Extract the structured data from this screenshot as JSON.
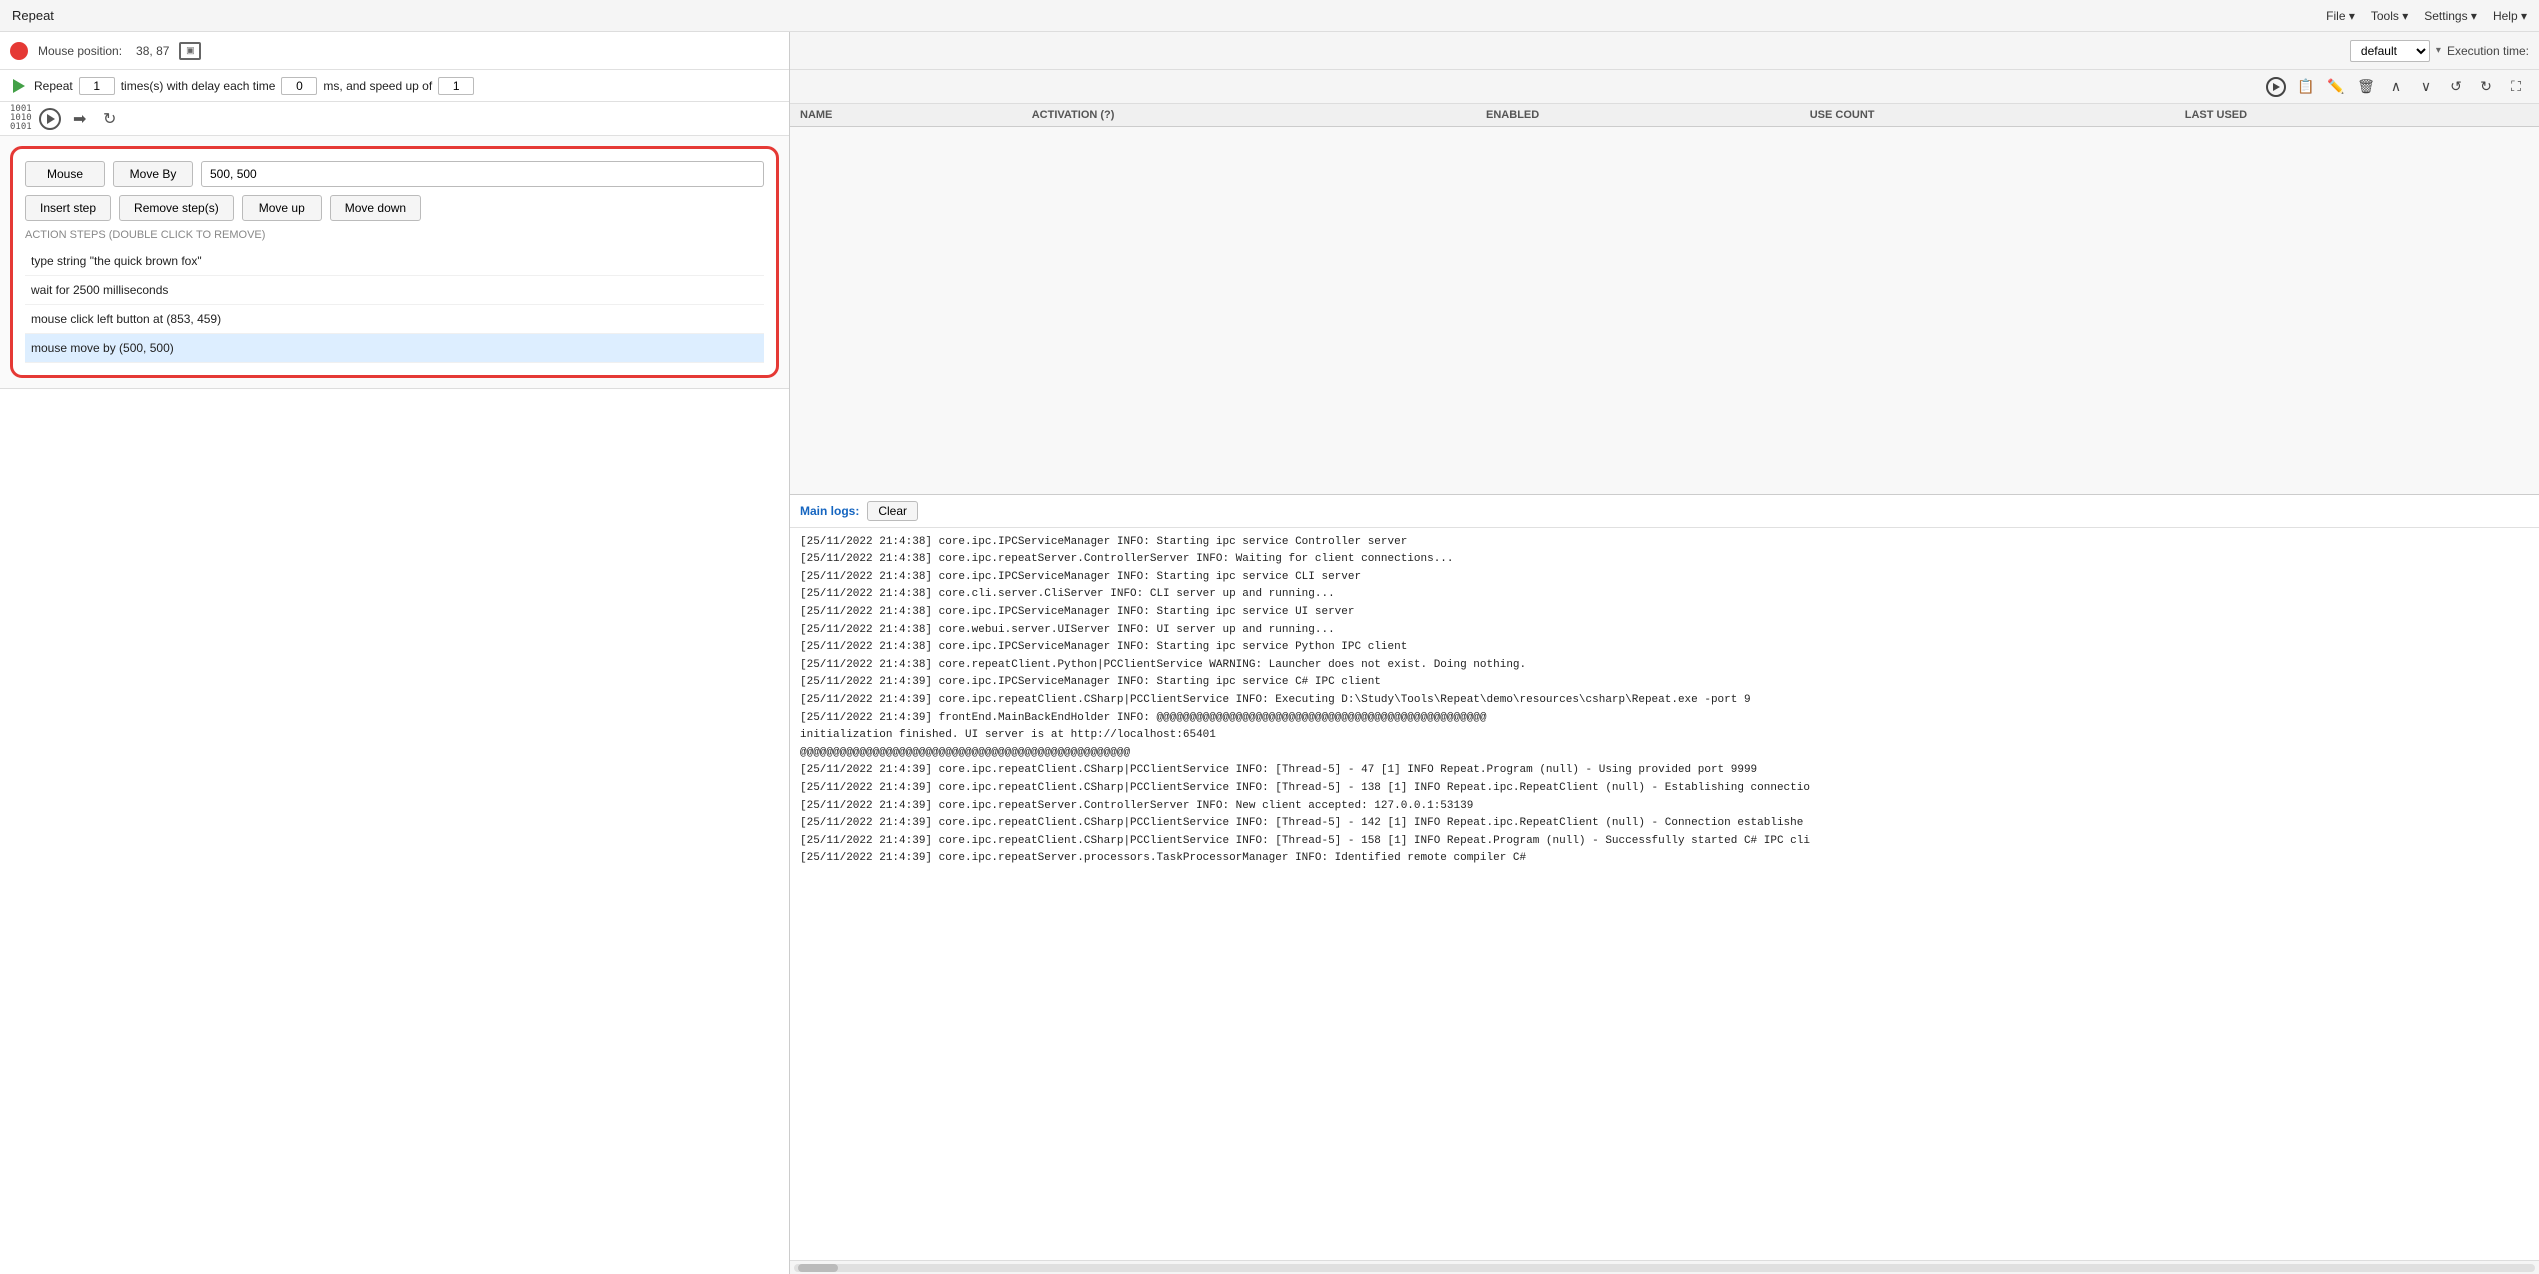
{
  "titlebar": {
    "title": "Repeat",
    "menu": [
      "File ▾",
      "Tools ▾",
      "Settings ▾",
      "Help ▾"
    ]
  },
  "toolbar": {
    "mouse_position_label": "Mouse position:",
    "mouse_position_value": "38, 87",
    "repeat_label": "Repeat",
    "repeat_times": "1",
    "repeat_delay_label": "times(s) with delay each time",
    "repeat_delay_value": "0",
    "repeat_speed_label": "ms, and speed up of",
    "repeat_speed_value": "1"
  },
  "step_editor": {
    "btn_mouse": "Mouse",
    "btn_move_by": "Move By",
    "input_value": "500, 500",
    "btn_insert": "Insert step",
    "btn_remove": "Remove step(s)",
    "btn_move_up": "Move up",
    "btn_move_down": "Move down",
    "action_label": "ACTION STEPS (DOUBLE CLICK TO REMOVE)",
    "steps": [
      {
        "text": "type string \"the quick brown fox\"",
        "selected": false
      },
      {
        "text": "wait for 2500 milliseconds",
        "selected": false
      },
      {
        "text": "mouse click left button at (853, 459)",
        "selected": false
      },
      {
        "text": "mouse move by (500, 500)",
        "selected": true
      }
    ]
  },
  "right_panel": {
    "profile": "default",
    "execution_time_label": "Execution time:",
    "table_headers": [
      "NAME",
      "ACTIVATION (?)",
      "ENABLED",
      "USE COUNT",
      "LAST USED"
    ],
    "rows": []
  },
  "logs": {
    "label": "Main logs:",
    "clear_btn": "Clear",
    "entries": [
      "[25/11/2022 21:4:38] core.ipc.IPCServiceManager INFO: Starting ipc service Controller server",
      "[25/11/2022 21:4:38] core.ipc.repeatServer.ControllerServer INFO: Waiting for client connections...",
      "[25/11/2022 21:4:38] core.ipc.IPCServiceManager INFO: Starting ipc service CLI server",
      "[25/11/2022 21:4:38] core.cli.server.CliServer INFO: CLI server up and running...",
      "[25/11/2022 21:4:38] core.ipc.IPCServiceManager INFO: Starting ipc service UI server",
      "[25/11/2022 21:4:38] core.webui.server.UIServer INFO: UI server up and running...",
      "[25/11/2022 21:4:38] core.ipc.IPCServiceManager INFO: Starting ipc service Python IPC client",
      "[25/11/2022 21:4:38] core.repeatClient.Python|PCClientService WARNING: Launcher does not exist. Doing nothing.",
      "[25/11/2022 21:4:39] core.ipc.IPCServiceManager INFO: Starting ipc service C# IPC client",
      "[25/11/2022 21:4:39] core.ipc.repeatClient.CSharp|PCClientService INFO: Executing D:\\Study\\Tools\\Repeat\\demo\\resources\\csharp\\Repeat.exe -port 9",
      "[25/11/2022 21:4:39] frontEnd.MainBackEndHolder INFO: @@@@@@@@@@@@@@@@@@@@@@@@@@@@@@@@@@@@@@@@@@@@@@@@@@",
      "initialization finished. UI server is at http://localhost:65401",
      "@@@@@@@@@@@@@@@@@@@@@@@@@@@@@@@@@@@@@@@@@@@@@@@@@@",
      "[25/11/2022 21:4:39] core.ipc.repeatClient.CSharp|PCClientService INFO: [Thread-5] - 47 [1] INFO Repeat.Program (null) - Using provided port 9999",
      "[25/11/2022 21:4:39] core.ipc.repeatClient.CSharp|PCClientService INFO: [Thread-5] - 138 [1] INFO Repeat.ipc.RepeatClient (null) - Establishing connectio",
      "[25/11/2022 21:4:39] core.ipc.repeatServer.ControllerServer INFO: New client accepted: 127.0.0.1:53139",
      "[25/11/2022 21:4:39] core.ipc.repeatClient.CSharp|PCClientService INFO: [Thread-5] - 142 [1] INFO Repeat.ipc.RepeatClient (null) - Connection establishe",
      "[25/11/2022 21:4:39] core.ipc.repeatClient.CSharp|PCClientService INFO: [Thread-5] - 158 [1] INFO Repeat.Program (null) - Successfully started C# IPC cli",
      "[25/11/2022 21:4:39] core.ipc.repeatServer.processors.TaskProcessorManager INFO: Identified remote compiler C#"
    ]
  }
}
